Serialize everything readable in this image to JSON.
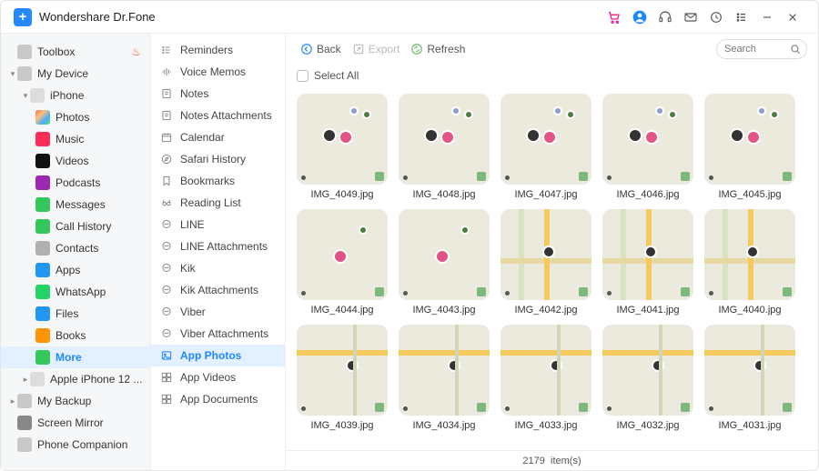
{
  "app": {
    "title": "Wondershare Dr.Fone"
  },
  "search": {
    "placeholder": "Search"
  },
  "toolbar": {
    "back": "Back",
    "export": "Export",
    "refresh": "Refresh"
  },
  "selectall": {
    "label": "Select All"
  },
  "sidebar": {
    "toolbox": "Toolbox",
    "mydevice": "My Device",
    "iphone": "iPhone",
    "items": [
      {
        "label": "Photos"
      },
      {
        "label": "Music"
      },
      {
        "label": "Videos"
      },
      {
        "label": "Podcasts"
      },
      {
        "label": "Messages"
      },
      {
        "label": "Call History"
      },
      {
        "label": "Contacts"
      },
      {
        "label": "Apps"
      },
      {
        "label": "WhatsApp"
      },
      {
        "label": "Files"
      },
      {
        "label": "Books"
      },
      {
        "label": "More"
      }
    ],
    "iphone12": "Apple iPhone 12 ...",
    "mybackup": "My Backup",
    "screenmirror": "Screen Mirror",
    "phonecompanion": "Phone Companion"
  },
  "cats": [
    {
      "label": "Reminders",
      "icon": "list"
    },
    {
      "label": "Voice Memos",
      "icon": "wave"
    },
    {
      "label": "Notes",
      "icon": "note"
    },
    {
      "label": "Notes Attachments",
      "icon": "note"
    },
    {
      "label": "Calendar",
      "icon": "cal"
    },
    {
      "label": "Safari History",
      "icon": "compass"
    },
    {
      "label": "Bookmarks",
      "icon": "bookmark"
    },
    {
      "label": "Reading List",
      "icon": "glasses"
    },
    {
      "label": "LINE",
      "icon": "chat"
    },
    {
      "label": "LINE Attachments",
      "icon": "chat"
    },
    {
      "label": "Kik",
      "icon": "chat"
    },
    {
      "label": "Kik Attachments",
      "icon": "chat"
    },
    {
      "label": "Viber",
      "icon": "chat"
    },
    {
      "label": "Viber Attachments",
      "icon": "chat"
    },
    {
      "label": "App Photos",
      "icon": "photo",
      "active": true
    },
    {
      "label": "App Videos",
      "icon": "grid"
    },
    {
      "label": "App Documents",
      "icon": "grid"
    }
  ],
  "thumbs": [
    {
      "label": "IMG_4049.jpg",
      "v": "a"
    },
    {
      "label": "IMG_4048.jpg",
      "v": "a"
    },
    {
      "label": "IMG_4047.jpg",
      "v": "a"
    },
    {
      "label": "IMG_4046.jpg",
      "v": "a"
    },
    {
      "label": "IMG_4045.jpg",
      "v": "a"
    },
    {
      "label": "IMG_4044.jpg",
      "v": "b"
    },
    {
      "label": "IMG_4043.jpg",
      "v": "b"
    },
    {
      "label": "IMG_4042.jpg",
      "v": "m2"
    },
    {
      "label": "IMG_4041.jpg",
      "v": "m2"
    },
    {
      "label": "IMG_4040.jpg",
      "v": "m2"
    },
    {
      "label": "IMG_4039.jpg",
      "v": "m"
    },
    {
      "label": "IMG_4034.jpg",
      "v": "m"
    },
    {
      "label": "IMG_4033.jpg",
      "v": "m"
    },
    {
      "label": "IMG_4032.jpg",
      "v": "m"
    },
    {
      "label": "IMG_4031.jpg",
      "v": "m"
    }
  ],
  "status": {
    "count": "2179",
    "suffix": "item(s)"
  }
}
